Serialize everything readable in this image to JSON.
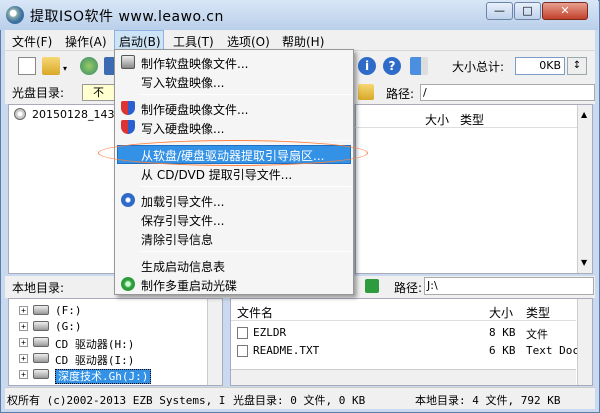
{
  "window": {
    "title": "提取ISO软件 www.leawo.cn",
    "min": "—",
    "max": "□",
    "close": "✕"
  },
  "menubar": {
    "items": [
      "文件(F)",
      "操作(A)",
      "启动(B)",
      "工具(T)",
      "选项(O)",
      "帮助(H)"
    ]
  },
  "toolbar": {
    "total_label": "大小总计:",
    "total_value": "0KB",
    "unit": "↕"
  },
  "disc_dir": {
    "label": "光盘目录:",
    "value": "不",
    "path_label": "路径:",
    "path_value": "/"
  },
  "upper_tree": {
    "item": "20150128_1430"
  },
  "upper_list": {
    "columns": [
      "大小",
      "类型"
    ]
  },
  "local_dir": {
    "label": "本地目录:",
    "path_label": "路径:",
    "path_value": "J:\\"
  },
  "lower_tree": {
    "items": [
      {
        "label": "(F:)"
      },
      {
        "label": "(G:)"
      },
      {
        "label": "CD 驱动器(H:)"
      },
      {
        "label": "CD 驱动器(I:)"
      },
      {
        "label": "深度技术.Gh(J:)"
      }
    ]
  },
  "lower_list": {
    "columns": [
      "文件名",
      "大小",
      "类型"
    ],
    "rows": [
      {
        "name": "EZLDR",
        "size": "8 KB",
        "type": "文件"
      },
      {
        "name": "README.TXT",
        "size": "6 KB",
        "type": "Text Doc"
      }
    ]
  },
  "status": {
    "copyright": "权所有 (c)2002-2013 EZB Systems, I",
    "disc": "光盘目录: 0 文件, 0 KB",
    "local": "本地目录: 4 文件, 792 KB"
  },
  "dropdown": {
    "items": [
      "制作软盘映像文件...",
      "写入软盘映像...",
      "制作硬盘映像文件...",
      "写入硬盘映像...",
      "从软盘/硬盘驱动器提取引导扇区...",
      "从 CD/DVD 提取引导文件...",
      "加载引导文件...",
      "保存引导文件...",
      "清除引导信息",
      "生成启动信息表",
      "制作多重启动光碟"
    ]
  },
  "colors": {
    "highlight": "#3391e6",
    "annotation": "#ff8040",
    "titlebar": "#c9daf0"
  }
}
